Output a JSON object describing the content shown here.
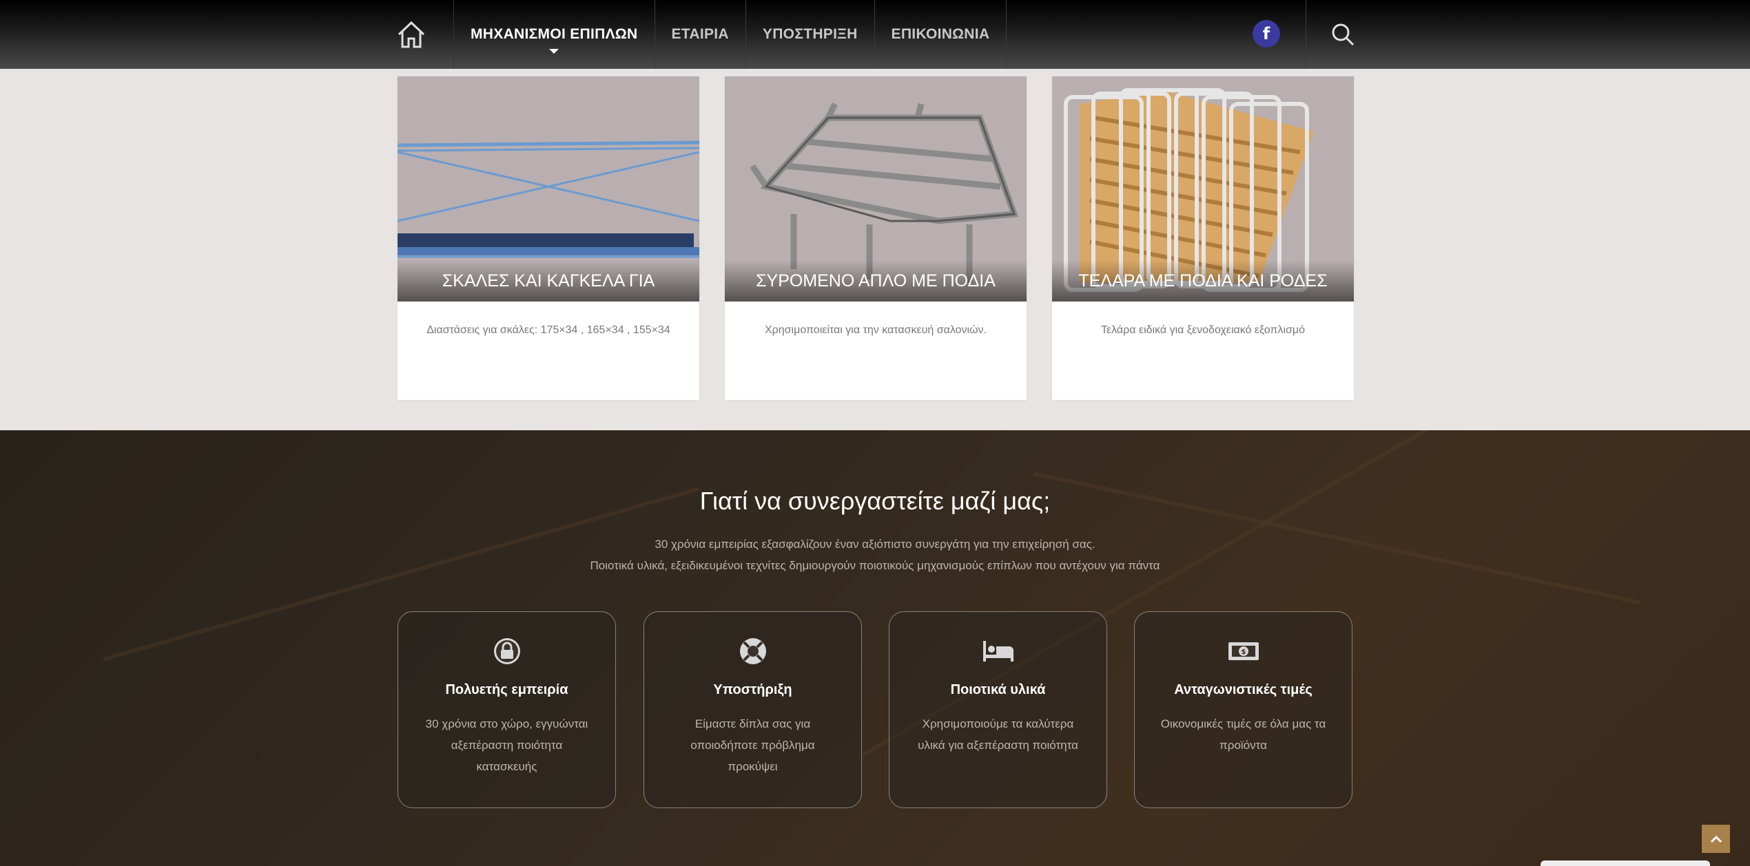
{
  "nav": {
    "home_icon": "home-icon",
    "items": [
      {
        "label": "ΜΗΧΑΝΙΣΜΟΙ ΕΠΙΠΛΩΝ",
        "active": true
      },
      {
        "label": "ΕΤΑΙΡΙΑ"
      },
      {
        "label": "ΥΠΟΣΤΗΡΙΞΗ"
      },
      {
        "label": "ΕΠΙΚΟΙΝΩΝΙΑ"
      }
    ],
    "facebook_icon": "facebook-icon",
    "facebook_letter": "f",
    "search_icon": "search-icon",
    "facebook_color": "#3b3aa0"
  },
  "products": [
    {
      "title": "ΣΚΑΛΕΣ ΚΑΙ ΚΑΓΚΕΛΑ ΓΙΑ ΚΟΥΚΕΤΕΣ",
      "desc": "Διαστάσεις για σκάλες: 175×34 , 165×34 , 155×34"
    },
    {
      "title": "ΣΥΡΟΜΕΝΟ ΑΠΛΟ ΜΕ ΠΟΔΙΑ",
      "desc": "Χρησιμοποιείται για την κατασκευή σαλονιών."
    },
    {
      "title": "ΤΕΛΑΡΑ ΜΕ ΠΟΔΙΑ ΚΑΙ ΡΟΔΕΣ",
      "desc": "Τελάρα ειδικά για ξενοδοχειακό εξοπλισμό"
    }
  ],
  "why": {
    "title": "Γιατί να συνεργαστείτε μαζί μας;",
    "line1": "30 χρόνια εμπειρίας εξασφαλίζουν έναν αξιόπιστο συνεργάτη για την επιχείρησή σας.",
    "line2": "Ποιοτικά υλικά, εξειδικευμένοι τεχνίτες δημιουργούν ποιοτικούς μηχανισμούς επίπλων που αντέχουν για πάντα",
    "features": [
      {
        "icon": "lock-icon",
        "title": "Πολυετής εμπειρία",
        "text": "30 χρόνια στο χώρο, εγγυώνται αξεπέραστη ποιότητα κατασκευής"
      },
      {
        "icon": "lifebuoy-icon",
        "title": "Υποστήριξη",
        "text": "Είμαστε δίπλα σας για οποιοδήποτε πρόβλημα προκύψει"
      },
      {
        "icon": "bed-icon",
        "title": "Ποιοτικά υλικά",
        "text": "Χρησιμοποιούμε τα καλύτερα υλικά για αξεπέραστη ποιότητα"
      },
      {
        "icon": "money-icon",
        "title": "Ανταγωνιστικές τιμές",
        "text": "Οικονομικές τιμές σε όλα μας τα προϊόντα"
      }
    ]
  },
  "scroll_top_icon": "chevron-up-icon",
  "accent_color": "#a8804a"
}
